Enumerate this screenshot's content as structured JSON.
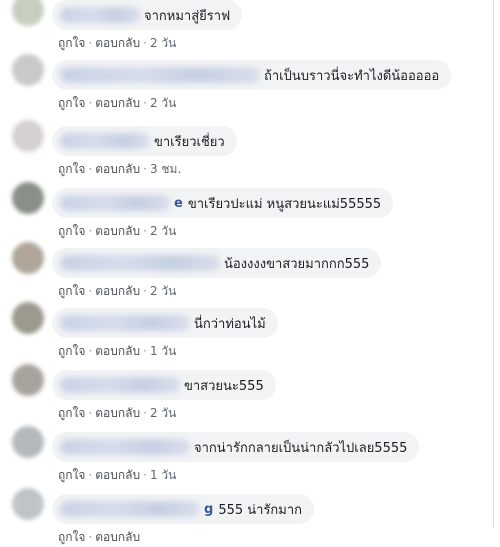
{
  "comments": [
    {
      "name_tail": "",
      "text": "จากหมาสู่ยีราฟ",
      "like": "ถูกใจ",
      "reply": "ตอบกลับ",
      "time": "2 วัน",
      "avatar_color": "#c8cfc0"
    },
    {
      "name_tail": "",
      "text": "ถ้าเป็นบราวนี่จะทำไงดีน้อออออ",
      "like": "ถูกใจ",
      "reply": "ตอบกลับ",
      "time": "2 วัน",
      "avatar_color": "#c9c9c9"
    },
    {
      "name_tail": "",
      "text": "ขาเรียวเชี่ยว",
      "like": "ถูกใจ",
      "reply": "ตอบกลับ",
      "time": "3 ชม.",
      "avatar_color": "#d5d1d3"
    },
    {
      "name_tail": "e",
      "text": "ขาเรียวปะแม่ หนูสวยนะแม่55555",
      "like": "ถูกใจ",
      "reply": "ตอบกลับ",
      "time": "2 วัน",
      "avatar_color": "#8a8f88"
    },
    {
      "name_tail": "",
      "text": "น้องงงงขาสวยมากกก555",
      "like": "ถูกใจ",
      "reply": "ตอบกลับ",
      "time": "2 วัน",
      "avatar_color": "#b0a79a"
    },
    {
      "name_tail": "",
      "text": "นี่กว่าท่อนไม้",
      "like": "ถูกใจ",
      "reply": "ตอบกลับ",
      "time": "1 วัน",
      "avatar_color": "#9c9a8e"
    },
    {
      "name_tail": "",
      "text": "ขาสวยนะ555",
      "like": "ถูกใจ",
      "reply": "ตอบกลับ",
      "time": "2 วัน",
      "avatar_color": "#a9a39d"
    },
    {
      "name_tail": "",
      "text": "จากน่ารักกลายเป็นน่ากลัวไปเลย5555",
      "like": "ถูกใจ",
      "reply": "ตอบกลับ",
      "time": "1 วัน",
      "avatar_color": "#b5b8bb"
    },
    {
      "name_tail": "g",
      "text": "555 น่ารักมาก",
      "like": "ถูกใจ",
      "reply": "ตอบกลับ",
      "time": "",
      "avatar_color": "#c0c4c8"
    }
  ]
}
